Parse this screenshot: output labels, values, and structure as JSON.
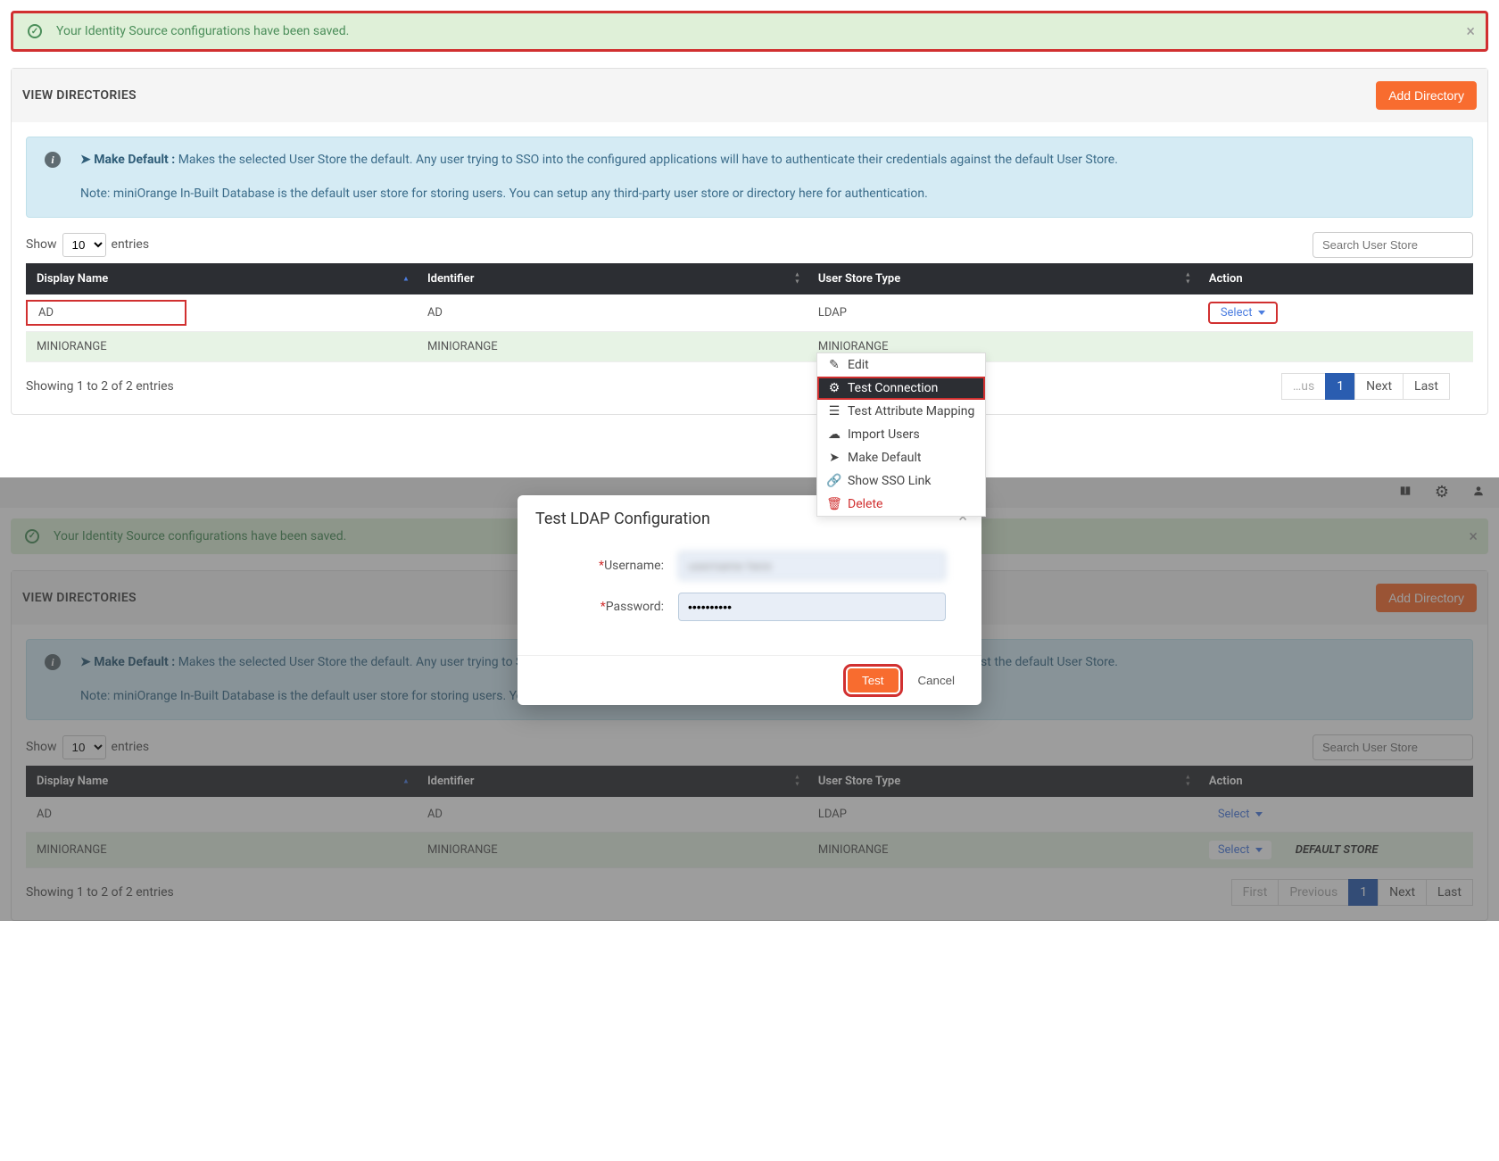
{
  "alert": {
    "message": "Your Identity Source configurations have been saved."
  },
  "card": {
    "title": "VIEW DIRECTORIES",
    "addBtn": "Add Directory"
  },
  "info": {
    "prefixIcon": "pointer",
    "boldLabel": "Make Default :",
    "text": " Makes the selected User Store the default. Any user trying to SSO into the configured applications will have to authenticate their credentials against the default User Store.",
    "note": "Note: miniOrange In-Built Database is the default user store for storing users. You can setup any third-party user store or directory here for authentication."
  },
  "tableCtrl": {
    "showLabel": "Show",
    "pageSize": "10",
    "entriesLabel": "entries",
    "searchPlaceholder": "Search User Store"
  },
  "headers": {
    "displayName": "Display Name",
    "identifier": "Identifier",
    "userStoreType": "User Store Type",
    "action": "Action"
  },
  "rows": [
    {
      "display": "AD",
      "identifier": "AD",
      "type": "LDAP",
      "selectLabel": "Select"
    },
    {
      "display": "MINIORANGE",
      "identifier": "MINIORANGE",
      "type": "MINIORANGE",
      "selectLabel": "Select",
      "defaultStore": "DEFAULT STORE"
    }
  ],
  "footer": {
    "info": "Showing 1 to 2 of 2 entries",
    "pager": {
      "first": "First",
      "previous": "Previous",
      "page": "1",
      "next": "Next",
      "last": "Last"
    }
  },
  "dropdown": {
    "edit": "Edit",
    "testConn": "Test Connection",
    "testAttr": "Test Attribute Mapping",
    "import": "Import Users",
    "makeDefault": "Make Default",
    "showSSO": "Show SSO Link",
    "delete": "Delete"
  },
  "modal": {
    "title": "Test LDAP Configuration",
    "usernameLabel": "Username:",
    "passwordLabel": "Password:",
    "passwordValue": "••••••••••",
    "testBtn": "Test",
    "cancelBtn": "Cancel"
  },
  "section2Pager": {
    "first": "First",
    "previous": "Previous",
    "page": "1",
    "next": "Next",
    "last": "Last"
  }
}
